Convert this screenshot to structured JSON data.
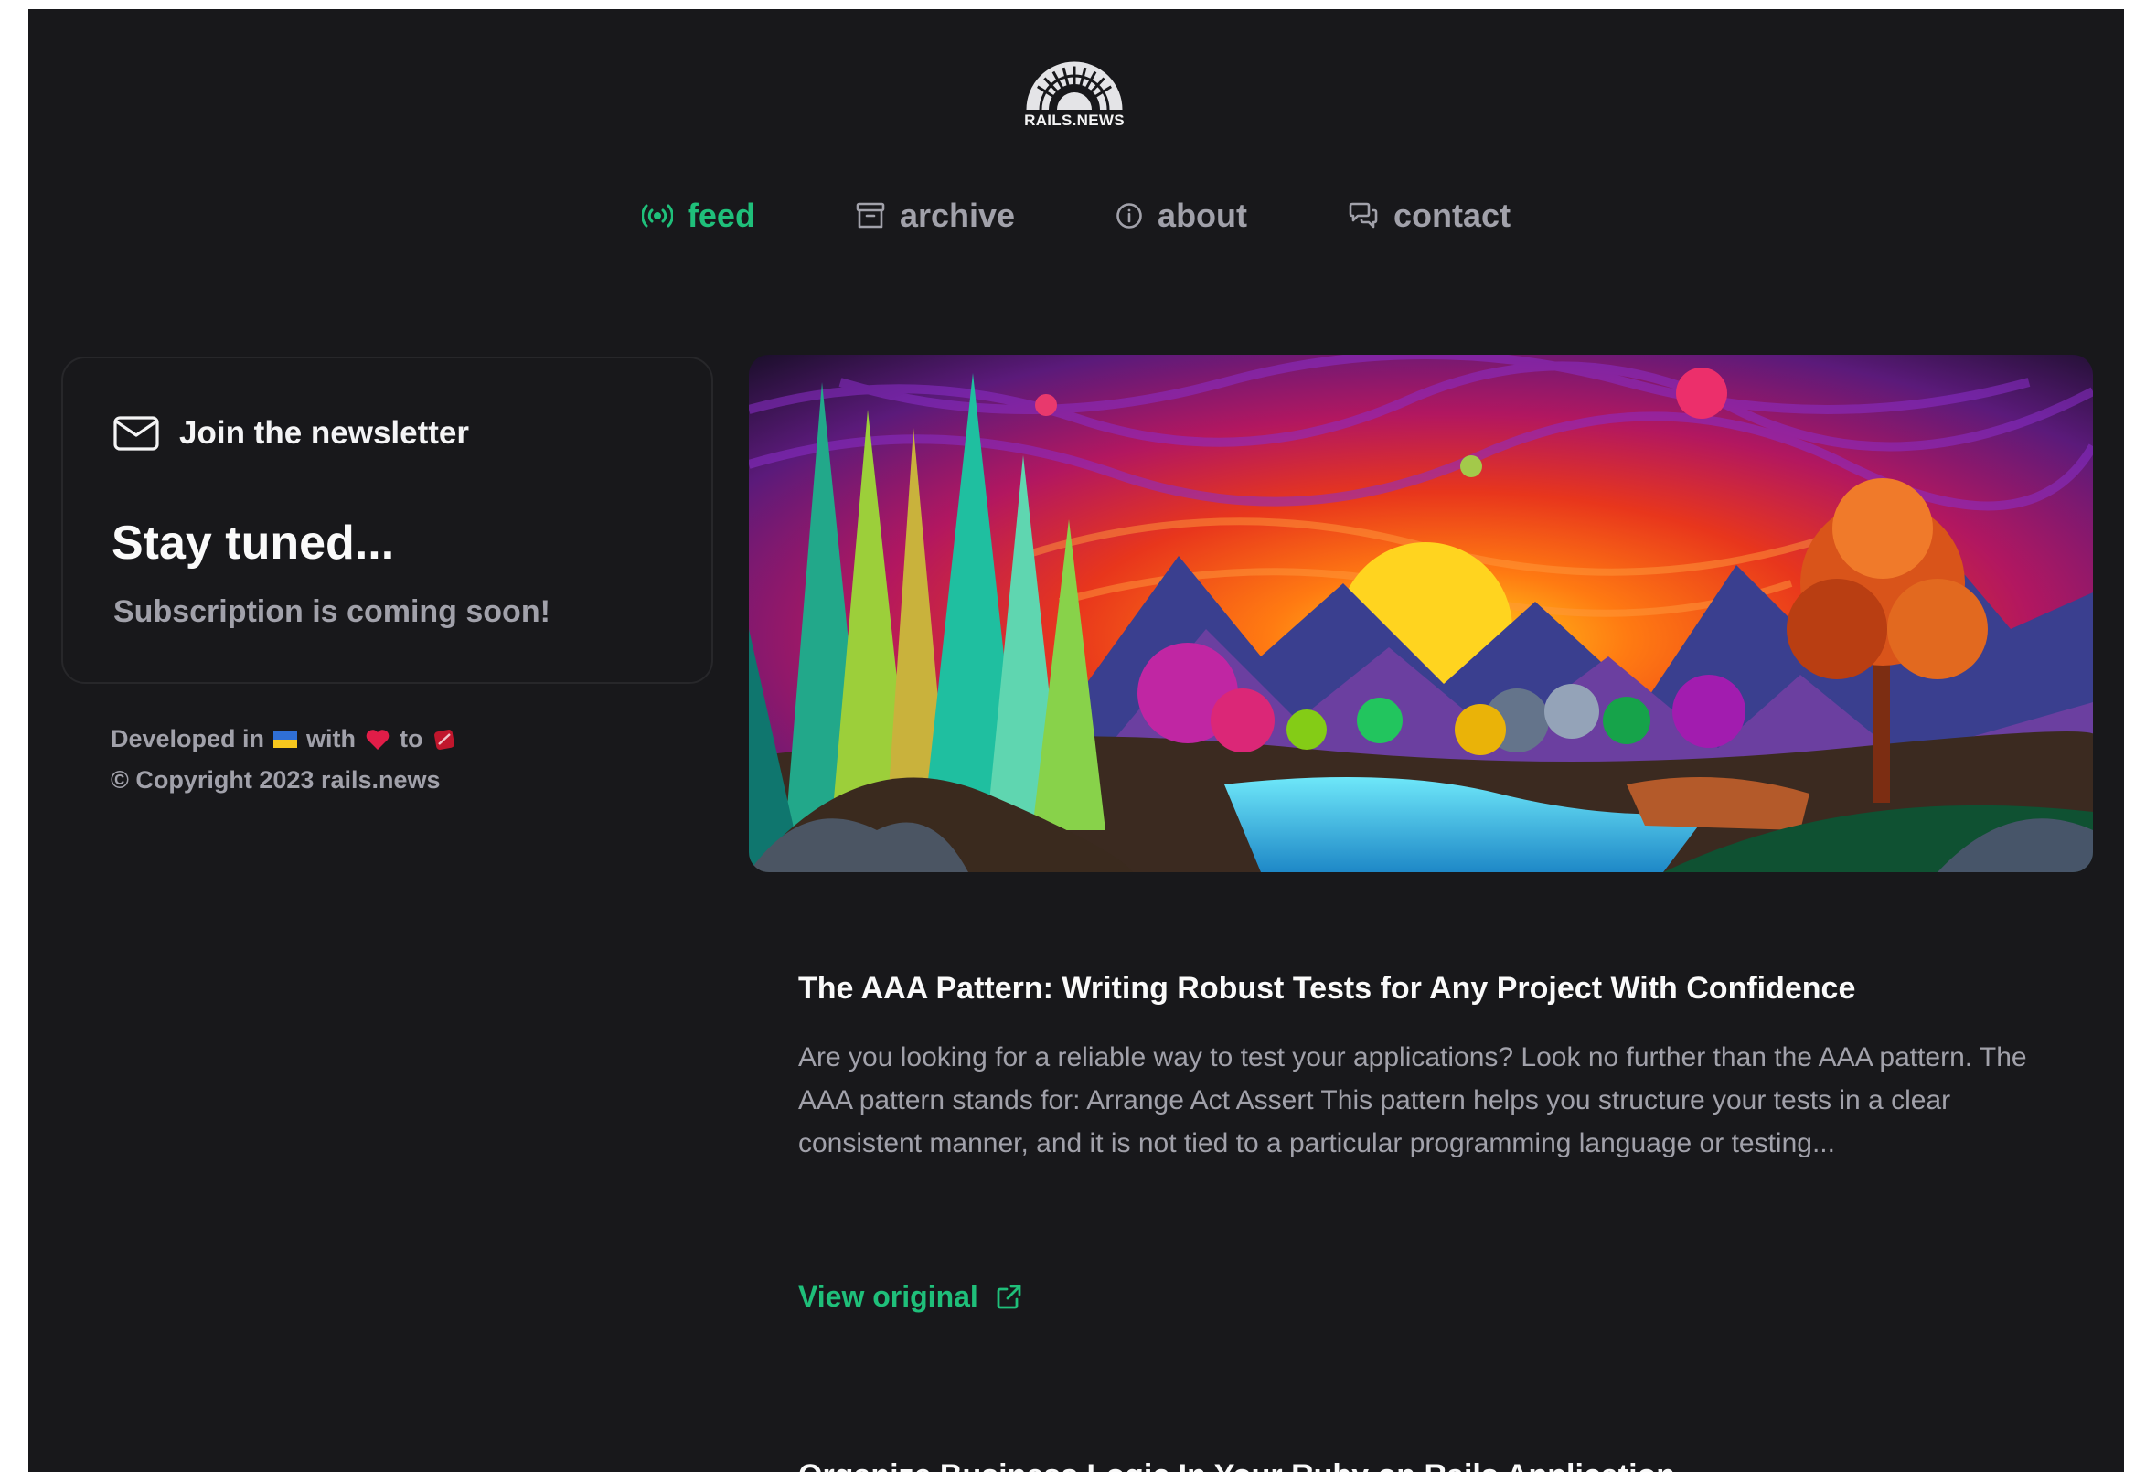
{
  "brand": {
    "logo_text": "RAILS.NEWS"
  },
  "nav": {
    "items": [
      {
        "label": "feed",
        "icon": "broadcast-icon",
        "active": true
      },
      {
        "label": "archive",
        "icon": "archive-box-icon",
        "active": false
      },
      {
        "label": "about",
        "icon": "info-circle-icon",
        "active": false
      },
      {
        "label": "contact",
        "icon": "chat-bubbles-icon",
        "active": false
      }
    ]
  },
  "newsletter": {
    "heading": "Join the newsletter",
    "title": "Stay tuned...",
    "subtitle": "Subscription is coming soon!"
  },
  "footer": {
    "developed_prefix": "Developed in",
    "with": "with",
    "to": "to",
    "copyright": "© Copyright 2023 rails.news"
  },
  "article": {
    "title": "The AAA Pattern: Writing Robust Tests for Any Project With Confidence",
    "excerpt": "Are you looking for a reliable way to test your applications? Look no further than the AAA pattern. The AAA pattern stands for: Arrange Act Assert This pattern helps you structure your tests in a clear consistent manner, and it is not tied to a particular programming language or testing...",
    "link_label": "View original"
  },
  "next_article": {
    "title_partial": "Organize Business Logic In Your Ruby on Rails Application"
  },
  "colors": {
    "background": "#18181b",
    "accent": "#1fbf7a",
    "muted_text": "#a1a1aa",
    "text": "#fafafa"
  }
}
